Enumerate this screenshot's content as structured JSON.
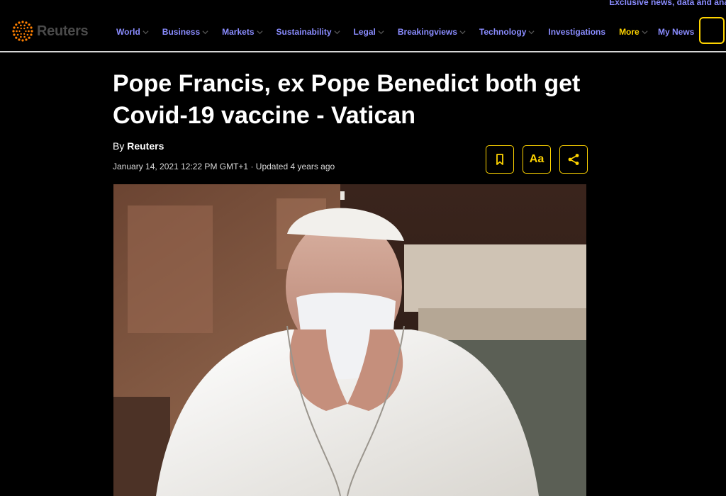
{
  "promo": {
    "text": "Exclusive news, data and ana"
  },
  "brand": {
    "name": "Reuters",
    "logo_icon": "reuters-dot-ring-logo"
  },
  "nav": {
    "items": [
      {
        "label": "World",
        "dropdown": true
      },
      {
        "label": "Business",
        "dropdown": true
      },
      {
        "label": "Markets",
        "dropdown": true
      },
      {
        "label": "Sustainability",
        "dropdown": true
      },
      {
        "label": "Legal",
        "dropdown": true
      },
      {
        "label": "Breakingviews",
        "dropdown": true
      },
      {
        "label": "Technology",
        "dropdown": true
      },
      {
        "label": "Investigations",
        "dropdown": false
      },
      {
        "label": "More",
        "dropdown": true
      }
    ],
    "my_news": "My News"
  },
  "article": {
    "headline": "Pope Francis, ex Pope Benedict both get Covid-19 vaccine - Vatican",
    "by_prefix": "By",
    "author": "Reuters",
    "dateline": "January 14, 2021 12:22 PM GMT+1 · Updated 4 years ago",
    "tools": {
      "bookmark_icon": "bookmark-icon",
      "text_size_label": "Aa",
      "share_icon": "share-icon"
    }
  },
  "colors": {
    "background": "#000000",
    "nav_link": "#8a8cff",
    "accent": "#ffd400",
    "logo_orange": "#ff8000"
  }
}
